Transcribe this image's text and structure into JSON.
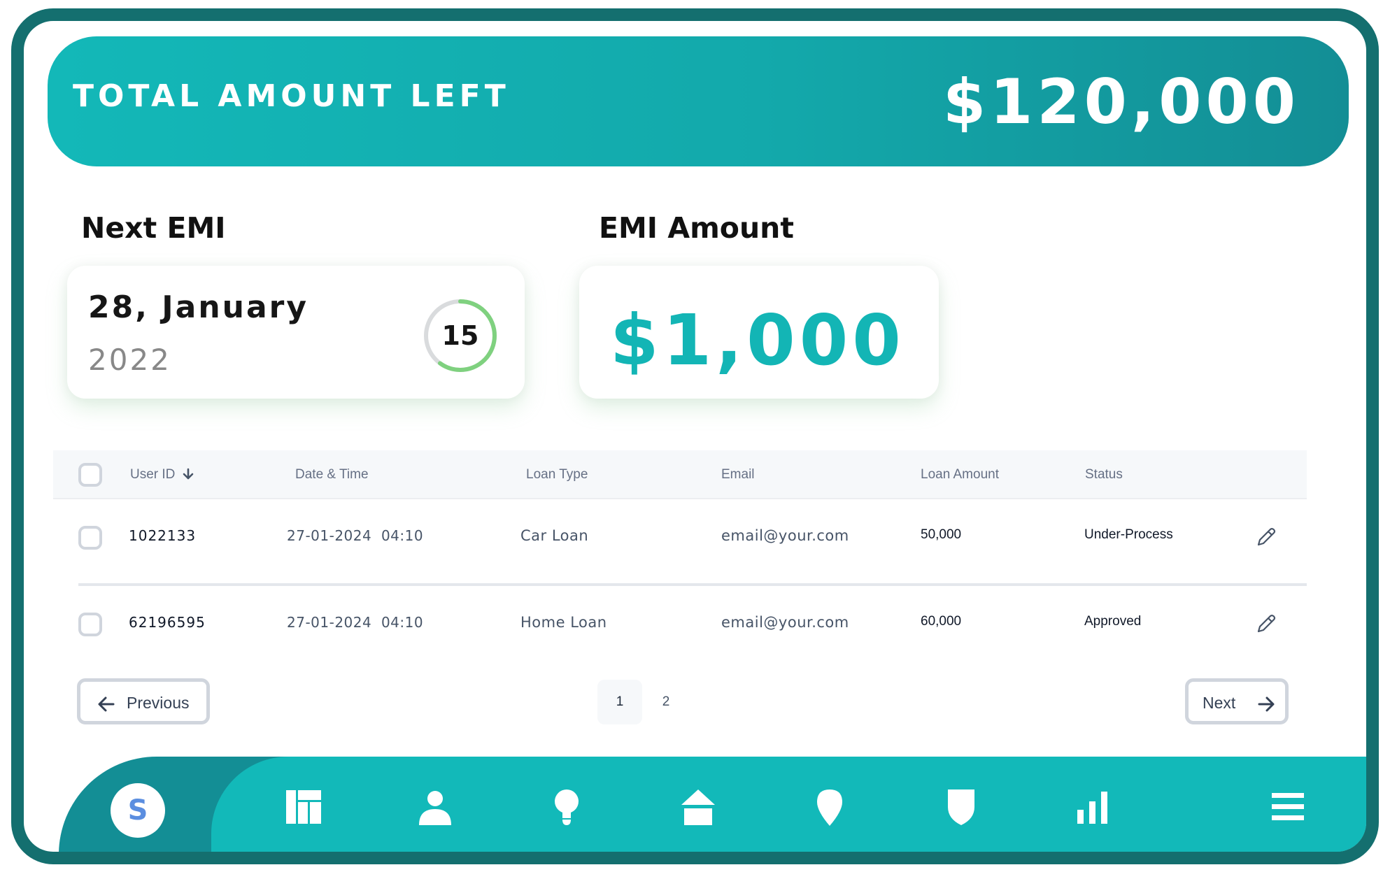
{
  "header": {
    "title": "TOTAL AMOUNT LEFT",
    "amount": "$120,000"
  },
  "next_emi": {
    "label": "Next EMI",
    "date": "28, January",
    "year": "2022",
    "days_left": "15",
    "progress_fraction": 0.6
  },
  "emi_amount": {
    "label": "EMI Amount",
    "value": "$1,000"
  },
  "table": {
    "headers": [
      "User ID",
      "Date & Time",
      "Loan Type",
      "Email",
      "Loan Amount",
      "Status"
    ],
    "rows": [
      {
        "user_id": "1022133",
        "date_time": "27-01-2024  04:10",
        "loan_type": "Car Loan",
        "email": "email@your.com",
        "loan_amount": "50,000",
        "status": "Under-Process"
      },
      {
        "user_id": "62196595",
        "date_time": "27-01-2024  04:10",
        "loan_type": "Home Loan",
        "email": "email@your.com",
        "loan_amount": "60,000",
        "status": "Approved"
      }
    ]
  },
  "pagination": {
    "previous_label": "Previous",
    "next_label": "Next",
    "pages": [
      "1",
      "2"
    ],
    "current_page": "1"
  },
  "bottom_nav": {
    "avatar_letter": "S",
    "items": [
      "dashboard-icon",
      "user-icon",
      "lightbulb-icon",
      "home-icon",
      "location-pin-icon",
      "shield-icon",
      "bar-chart-icon",
      "menu-icon"
    ]
  },
  "colors": {
    "teal": "#13b8b8",
    "teal_dark": "#138e95",
    "frame": "#146f6f",
    "progress_ring": "#7fd17f"
  }
}
